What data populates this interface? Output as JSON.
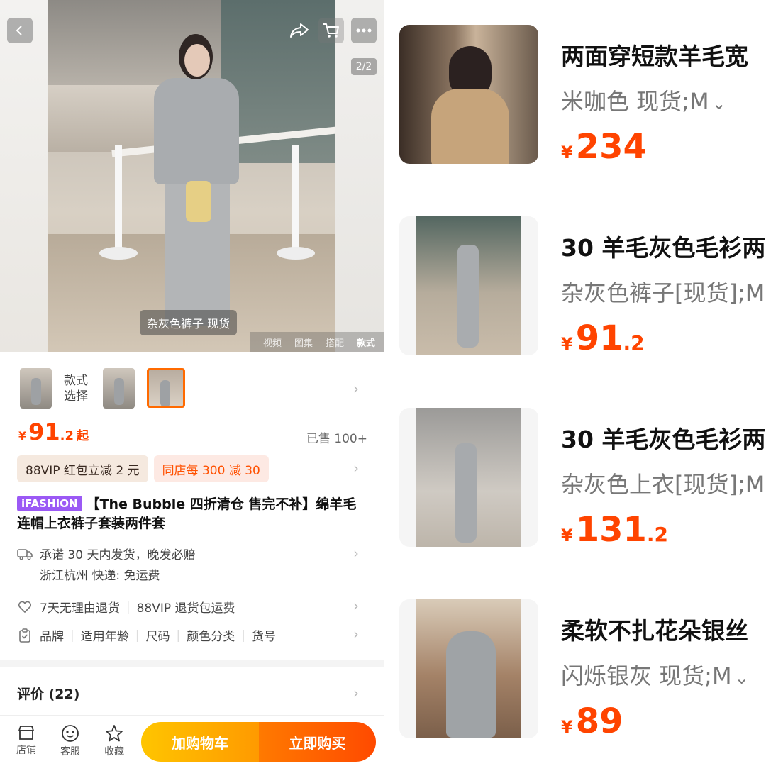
{
  "left": {
    "hero": {
      "pager": "2/2",
      "caption": "杂灰色裤子 现货",
      "media_tabs": [
        "视频",
        "图集",
        "搭配",
        "款式"
      ],
      "active_media_tab": "款式"
    },
    "variants": {
      "label": "款式选择",
      "selected_index": 2
    },
    "price": {
      "symbol": "¥",
      "int": "91",
      "dec": ".2",
      "suffix": "起"
    },
    "sold": "已售 100+",
    "coupons": {
      "vip": "88VIP 红包立减 2 元",
      "shop": "同店每 300 减 30"
    },
    "title": {
      "brand": "iFASHION",
      "text": "【The Bubble 四折清仓 售完不补】绵羊毛连帽上衣裤子套装两件套"
    },
    "shipping": {
      "line1": "承诺 30 天内发货，晚发必赔",
      "line2": "浙江杭州  快递: 免运费"
    },
    "guarantee": {
      "a": "7天无理由退货",
      "b": "88VIP 退货包运费"
    },
    "params": [
      "品牌",
      "适用年龄",
      "尺码",
      "颜色分类",
      "货号"
    ],
    "reviews": "评价 (22)",
    "bottom_bar": {
      "shop": "店铺",
      "service": "客服",
      "favorite": "收藏",
      "add_cart": "加购物车",
      "buy_now": "立即购买"
    },
    "colors": {
      "accent": "#ff4400",
      "brand_tag": "#9b59f5"
    }
  },
  "right": {
    "items": [
      {
        "name": "两面穿短款羊毛宽",
        "spec": "米咖色 现货;M",
        "price_symbol": "¥",
        "price_int": "234",
        "price_dec": ""
      },
      {
        "name": "30 羊毛灰色毛衫两",
        "spec": "杂灰色裤子[现货];M",
        "price_symbol": "¥",
        "price_int": "91",
        "price_dec": ".2"
      },
      {
        "name": "30 羊毛灰色毛衫两",
        "spec": "杂灰色上衣[现货];M",
        "price_symbol": "¥",
        "price_int": "131",
        "price_dec": ".2"
      },
      {
        "name": "柔软不扎花朵银丝",
        "spec": "闪烁银灰 现货;M",
        "price_symbol": "¥",
        "price_int": "89",
        "price_dec": ""
      }
    ]
  }
}
